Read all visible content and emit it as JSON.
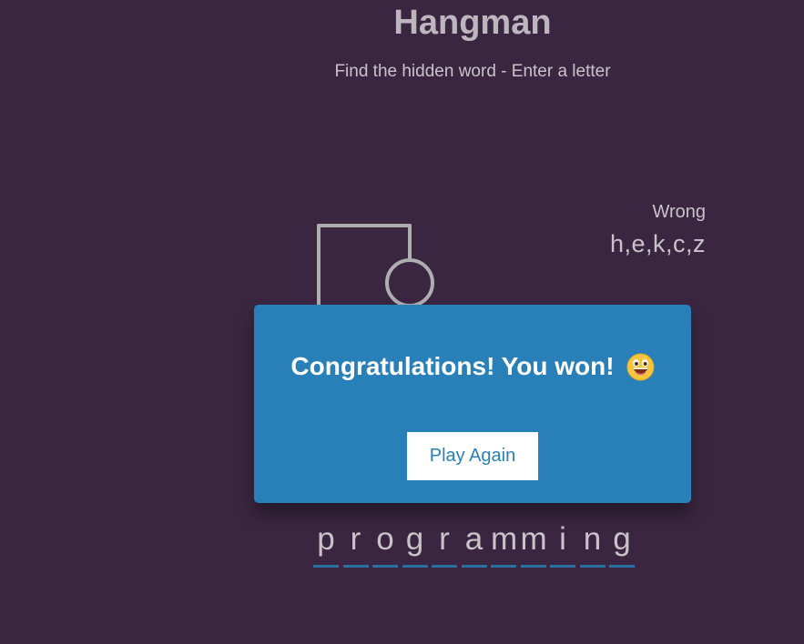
{
  "header": {
    "title": "Hangman",
    "subtitle": "Find the hidden word - Enter a letter"
  },
  "wrong": {
    "label": "Wrong",
    "letters": "h,e,k,c,z"
  },
  "word": [
    "p",
    "r",
    "o",
    "g",
    "r",
    "a",
    "m",
    "m",
    "i",
    "n",
    "g"
  ],
  "popup": {
    "message": "Congratulations! You won!",
    "emoji": "grinning-face-icon",
    "play_again_label": "Play Again"
  },
  "colors": {
    "background": "#3a2641",
    "popup": "#2980b9",
    "underline": "#2a6fa0",
    "figure": "#b0adb1"
  }
}
